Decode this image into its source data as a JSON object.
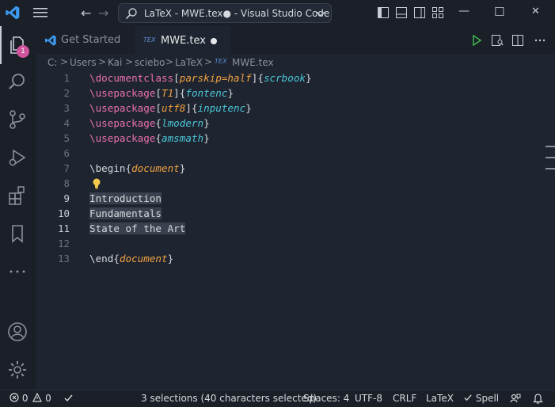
{
  "titlebar": {
    "window_title": "LaTeX - MWE.tex● - Visual Studio Code",
    "back_glyph": "←",
    "forward_glyph": "→",
    "minimize_glyph": "—",
    "maximize_glyph": "☐",
    "close_glyph": "✕"
  },
  "activity_bar": {
    "explorer_badge": "1",
    "items": [
      "files-icon",
      "search-icon",
      "source-control-icon",
      "run-debug-icon",
      "extensions-icon",
      "bookmark-icon",
      "more-icon",
      "account-icon",
      "settings-gear-icon"
    ]
  },
  "tabs": [
    {
      "label": "Get Started",
      "active": false
    },
    {
      "label": "MWE.tex",
      "active": true,
      "modified": true
    }
  ],
  "breadcrumb": {
    "parts": [
      "C:",
      "Users",
      "Kai",
      "sciebo",
      "LaTeX"
    ],
    "file_icon_text": "TEX",
    "file": "MWE.tex",
    "separator": ">"
  },
  "editor": {
    "line_numbers": [
      "1",
      "2",
      "3",
      "4",
      "5",
      "6",
      "7",
      "8",
      "9",
      "10",
      "11",
      "12",
      "13"
    ],
    "lines": [
      {
        "cmd": "\\documentclass",
        "o1": "[",
        "opt": "parskip=half",
        "c1": "]",
        "o2": "{",
        "arg": "scrbook",
        "c2": "}"
      },
      {
        "cmd": "\\usepackage",
        "o1": "[",
        "opt": "T1",
        "c1": "]",
        "o2": "{",
        "arg": "fontenc",
        "c2": "}"
      },
      {
        "cmd": "\\usepackage",
        "o1": "[",
        "opt": "utf8",
        "c1": "]",
        "o2": "{",
        "arg": "inputenc",
        "c2": "}"
      },
      {
        "cmd": "\\usepackage",
        "o2": "{",
        "arg": "lmodern",
        "c2": "}"
      },
      {
        "cmd": "\\usepackage",
        "o2": "{",
        "arg": "amsmath",
        "c2": "}"
      },
      {},
      {
        "cmd": "\\begin",
        "o2": "{",
        "arg": "document",
        "c2": "}"
      },
      {},
      {
        "text": "Introduction"
      },
      {
        "text": "Fundamentals"
      },
      {
        "text": "State of the Art"
      },
      {},
      {
        "cmd": "\\end",
        "o2": "{",
        "arg": "document",
        "c2": "}"
      }
    ]
  },
  "statusbar": {
    "errors": "0",
    "warnings": "0",
    "selections": "3 selections (40 characters selected)",
    "spaces": "Spaces: 4",
    "encoding": "UTF-8",
    "eol": "CRLF",
    "language": "LaTeX",
    "spell": "Spell"
  },
  "colors": {
    "accent_blue": "#3c9bf0",
    "badge": "#d0549b",
    "command": "#e870b0",
    "option": "#f0a040",
    "argument": "#4ac6d8",
    "run_green": "#3fb950"
  }
}
